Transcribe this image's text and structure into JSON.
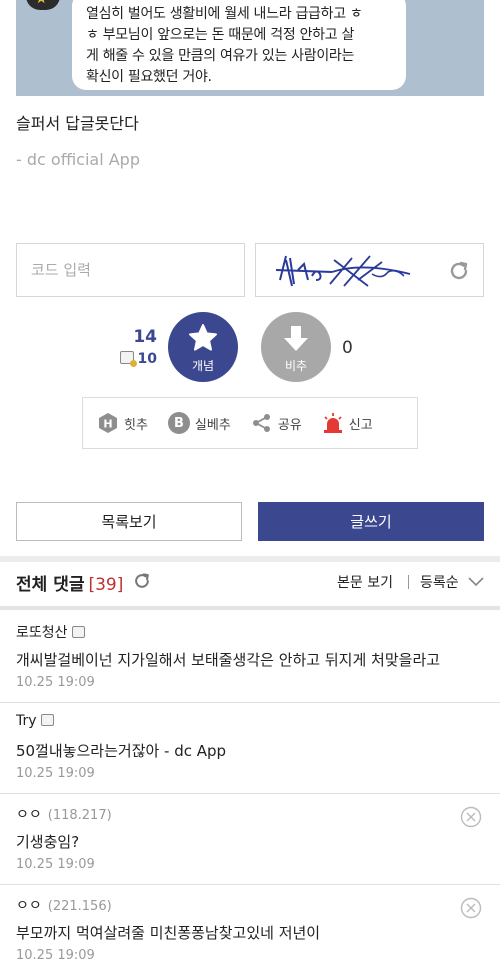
{
  "chat_image": {
    "lines": [
      "열심히 벌어도 생활비에 월세 내느라 급급하고 ㅎ",
      "ㅎ 부모님이 앞으로는 돈 때문에 걱정 안하고 살",
      "게 해줄 수 있을 만큼의 여유가 있는 사람이라는",
      "확신이 필요했던 거야."
    ]
  },
  "post": {
    "text": "슬퍼서 답글못단다",
    "app_sign": "- dc official App"
  },
  "captcha": {
    "input_placeholder": "코드 입력"
  },
  "votes": {
    "up_count": "14",
    "fixed_count": "10",
    "up_label": "개념",
    "down_label": "비추",
    "down_count": "0"
  },
  "actions": {
    "hit_recommend": "힛추",
    "best_recommend": "실베추",
    "share": "공유",
    "report": "신고"
  },
  "buttons": {
    "list": "목록보기",
    "write": "글쓰기"
  },
  "comments_header": {
    "title": "전체 댓글",
    "count": "[39]",
    "view_original": "본문 보기",
    "sort": "등록순"
  },
  "comments": [
    {
      "author": "로또청산",
      "ip": "",
      "body": "개씨발걸베이넌 지가일해서 보태줄생각은 안하고 뒤지게 처맞을라고",
      "date": "10.25 19:09"
    },
    {
      "author": "Try",
      "ip": "",
      "body": "50껄내놓으라는거잖아 - dc App",
      "date": "10.25 19:09"
    },
    {
      "author": "ㅇㅇ",
      "ip": "(118.217)",
      "body": "기생충임?",
      "date": "10.25 19:09"
    },
    {
      "author": "ㅇㅇ",
      "ip": "(221.156)",
      "body": "부모까지 먹여살려줄 미친퐁퐁남찾고있네 저년이",
      "date": "10.25 19:09"
    }
  ],
  "colors": {
    "accent": "#3b4890",
    "down": "#a8a8a8",
    "count_red": "#c22f2f",
    "report_red": "#e53935"
  }
}
